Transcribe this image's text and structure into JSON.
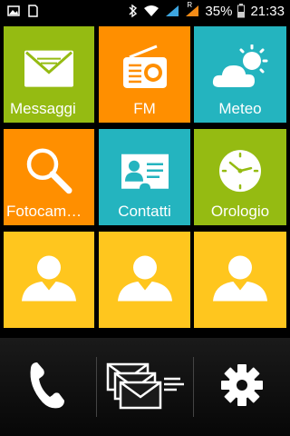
{
  "status_bar": {
    "battery": "35%",
    "time": "21:33",
    "signal_label": "R"
  },
  "tiles": [
    {
      "label": "Messaggi",
      "color": "#95bb12",
      "icon": "envelope-icon"
    },
    {
      "label": "FM",
      "color": "#ff8f00",
      "icon": "radio-icon"
    },
    {
      "label": "Meteo",
      "color": "#24b4bf",
      "icon": "weather-icon"
    },
    {
      "label": "Fotocamera",
      "display": "Fotocame…",
      "color": "#ff8f00",
      "icon": "magnifier-icon"
    },
    {
      "label": "Contatti",
      "color": "#24b4bf",
      "icon": "contact-card-icon"
    },
    {
      "label": "Orologio",
      "color": "#95bb12",
      "icon": "clock-icon"
    }
  ],
  "contact_color": "#ffc61e",
  "dock": {
    "items": [
      "phone-icon",
      "messages-icon",
      "settings-icon"
    ]
  }
}
